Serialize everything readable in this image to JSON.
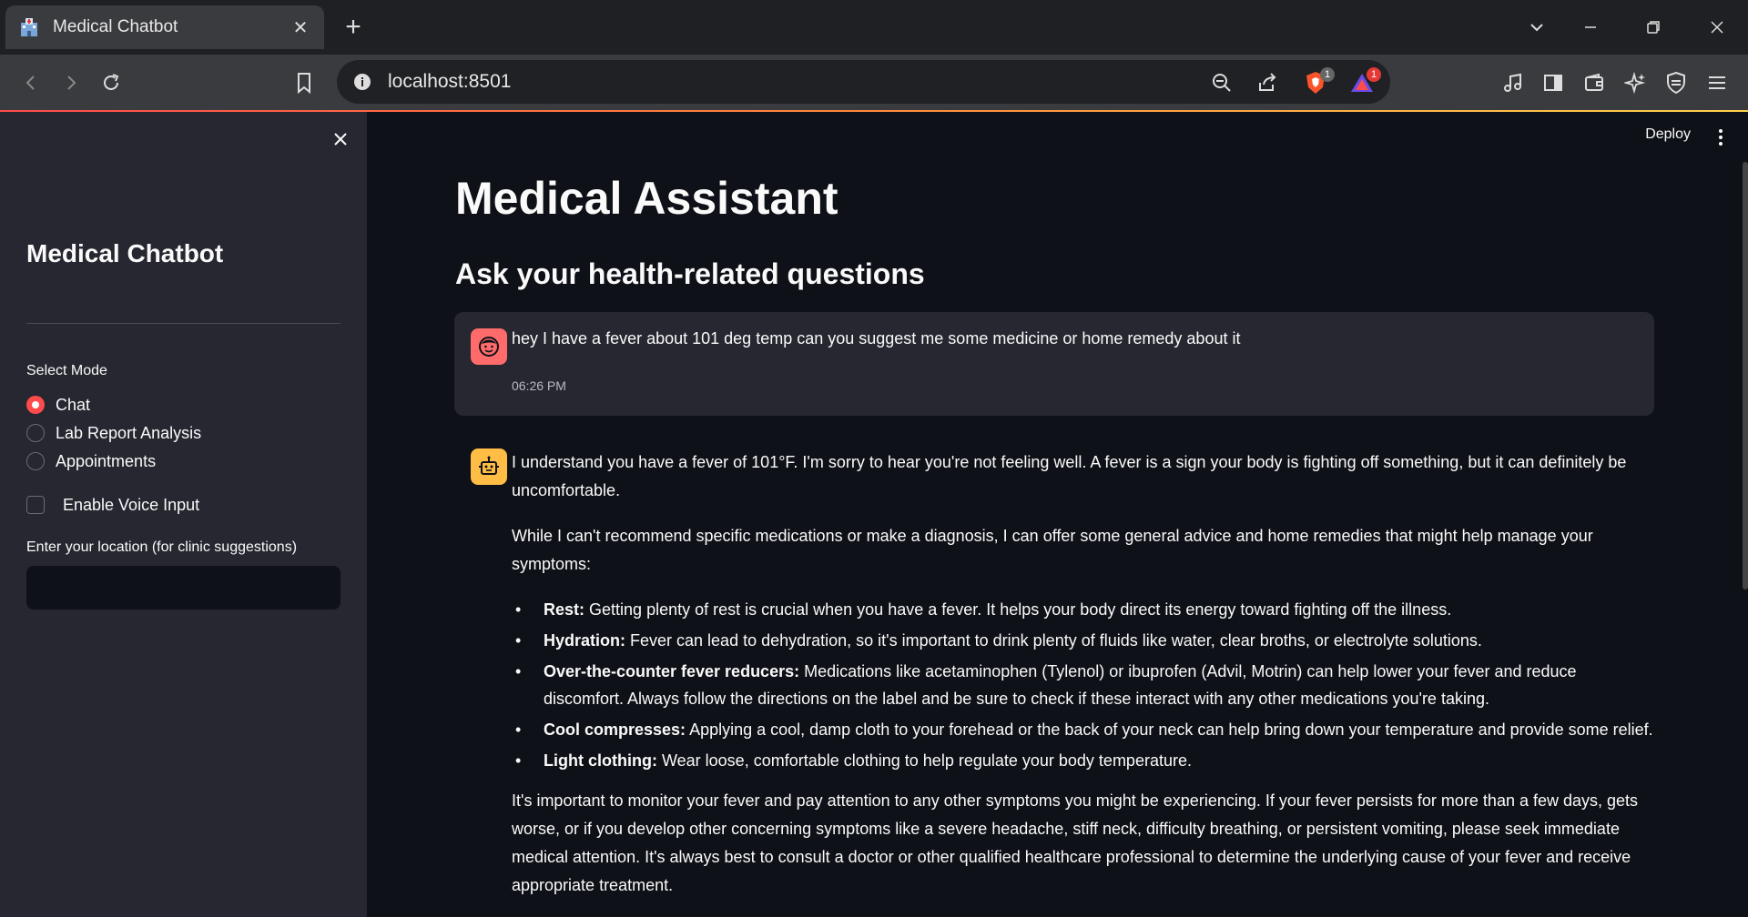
{
  "browser": {
    "tab_title": "Medical Chatbot",
    "url": "localhost:8501",
    "brave_badge": "1",
    "rewards_badge": "1",
    "icons": [
      "back-icon",
      "forward-icon",
      "reload-icon",
      "bookmark-icon",
      "info-icon",
      "zoom-out-icon",
      "share-icon",
      "brave-shield-icon",
      "brave-rewards-icon",
      "music-icon",
      "sidebar-icon",
      "wallet-icon",
      "leo-ai-icon",
      "vpn-icon",
      "menu-icon"
    ]
  },
  "sidebar": {
    "title": "Medical Chatbot",
    "mode_label": "Select Mode",
    "modes": [
      {
        "label": "Chat",
        "selected": true
      },
      {
        "label": "Lab Report Analysis",
        "selected": false
      },
      {
        "label": "Appointments",
        "selected": false
      }
    ],
    "voice_label": "Enable Voice Input",
    "voice_checked": false,
    "location_label": "Enter your location (for clinic suggestions)",
    "location_value": ""
  },
  "header": {
    "deploy_label": "Deploy"
  },
  "main": {
    "title": "Medical Assistant",
    "subtitle": "Ask your health-related questions"
  },
  "chat": {
    "user_message": {
      "text": "hey I have a fever about 101 deg temp can you suggest me some medicine or home remedy about it",
      "time": "06:26 PM"
    },
    "bot_message": {
      "intro": "I understand you have a fever of 101°F. I'm sorry to hear you're not feeling well. A fever is a sign your body is fighting off something, but it can definitely be uncomfortable.",
      "lead": "While I can't recommend specific medications or make a diagnosis, I can offer some general advice and home remedies that might help manage your symptoms:",
      "bullets": [
        {
          "title": "Rest:",
          "text": "Getting plenty of rest is crucial when you have a fever. It helps your body direct its energy toward fighting off the illness."
        },
        {
          "title": "Hydration:",
          "text": "Fever can lead to dehydration, so it's important to drink plenty of fluids like water, clear broths, or electrolyte solutions."
        },
        {
          "title": "Over-the-counter fever reducers:",
          "text": "Medications like acetaminophen (Tylenol) or ibuprofen (Advil, Motrin) can help lower your fever and reduce discomfort. Always follow the directions on the label and be sure to check if these interact with any other medications you're taking."
        },
        {
          "title": "Cool compresses:",
          "text": "Applying a cool, damp cloth to your forehead or the back of your neck can help bring down your temperature and provide some relief."
        },
        {
          "title": "Light clothing:",
          "text": "Wear loose, comfortable clothing to help regulate your body temperature."
        }
      ],
      "closing": "It's important to monitor your fever and pay attention to any other symptoms you might be experiencing. If your fever persists for more than a few days, gets worse, or if you develop other concerning symptoms like a severe headache, stiff neck, difficulty breathing, or persistent vomiting, please seek immediate medical attention. It's always best to consult a doctor or other qualified healthcare professional to determine the underlying cause of your fever and receive appropriate treatment."
    }
  },
  "colors": {
    "accent": "#ff4b4b",
    "user_avatar": "#ff6b6b",
    "bot_avatar": "#ffbd45"
  }
}
